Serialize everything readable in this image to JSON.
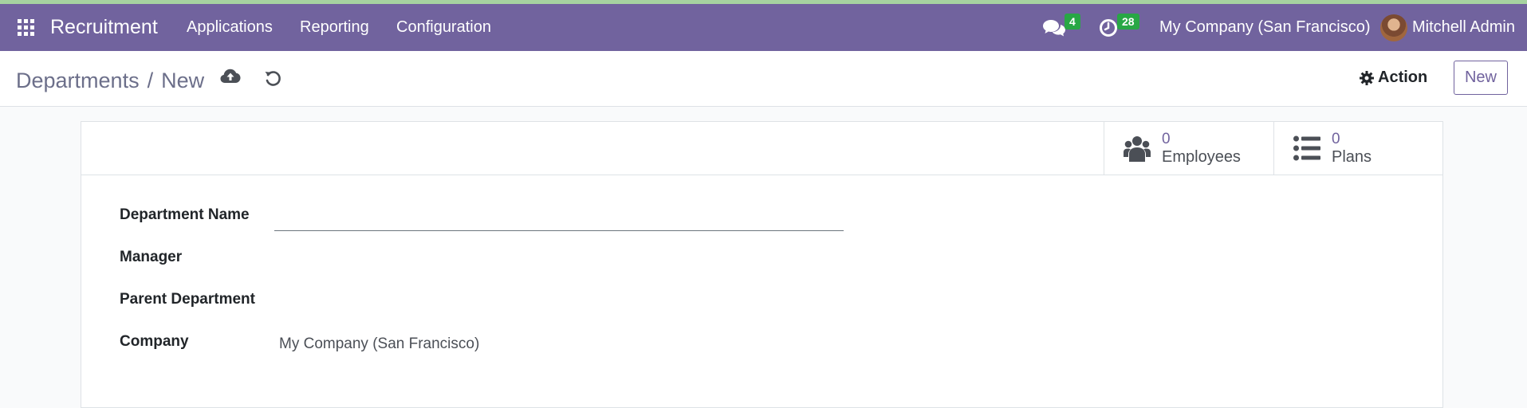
{
  "navbar": {
    "app_name": "Recruitment",
    "menus": [
      "Applications",
      "Reporting",
      "Configuration"
    ],
    "messages_count": "4",
    "activities_count": "28",
    "company": "My Company (San Francisco)",
    "user": "Mitchell Admin",
    "accent_color": "#71639e"
  },
  "control_panel": {
    "breadcrumb_parent": "Departments",
    "breadcrumb_separator": "/",
    "breadcrumb_current": "New",
    "action_label": "Action",
    "new_label": "New"
  },
  "stat_buttons": [
    {
      "value": "0",
      "label": "Employees",
      "icon": "users-icon"
    },
    {
      "value": "0",
      "label": "Plans",
      "icon": "list-icon"
    }
  ],
  "form": {
    "fields": [
      {
        "label": "Department Name",
        "value": ""
      },
      {
        "label": "Manager",
        "value": ""
      },
      {
        "label": "Parent Department",
        "value": ""
      },
      {
        "label": "Company",
        "value": "My Company (San Francisco)"
      }
    ]
  }
}
